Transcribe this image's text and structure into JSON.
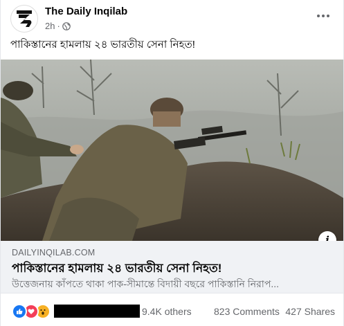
{
  "post": {
    "page_name": "The Daily Inqilab",
    "timestamp": "2h",
    "separator": "·",
    "audience_icon": "globe-icon",
    "caption": "পাকিস্তানের হামলায় ২৪ ভারতীয় সেনা নিহত!",
    "more_icon": "more-options-icon"
  },
  "link_preview": {
    "domain": "DAILYINQILAB.COM",
    "title": "পাকিস্তানের হামলায় ২৪ ভারতীয় সেনা নিহত!",
    "description": "উত্তেজনায় কাঁপতে থাকা পাক-সীমান্তে বিদায়ী বছরে পাকিস্তানি নিরাপ...",
    "info_label": "i"
  },
  "engagement": {
    "reaction_icons": [
      "like-icon",
      "love-icon",
      "wow-icon"
    ],
    "others": "9.4K others",
    "comments": "823 Comments",
    "shares": "427 Shares"
  },
  "colors": {
    "like": "#1877f2",
    "love": "#f33e58",
    "wow": "#f7b125",
    "secondary_text": "#65676b",
    "link_box_bg": "#f0f2f5"
  }
}
